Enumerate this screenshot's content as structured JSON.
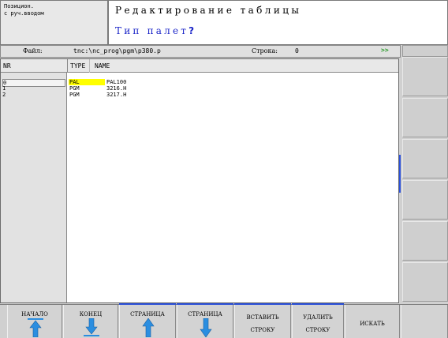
{
  "header": {
    "mode_text": "Позицион.\nс руч.вводом",
    "title": "Редактирование таблицы",
    "prompt": "Тип палет",
    "prompt_mark": "?"
  },
  "file_row": {
    "file_label": "Файл:",
    "path": "tnc:\\nc_prog\\pgm\\p380.p",
    "row_label": "Строка:",
    "row_value": "0",
    "more_indicator": ">>"
  },
  "table": {
    "columns": [
      "NR",
      "TYPE",
      "NAME"
    ],
    "rows": [
      {
        "nr": "0",
        "type": "PAL",
        "name": "PAL100",
        "selected": true
      },
      {
        "nr": "1",
        "type": "PGM",
        "name": "3216.H",
        "selected": false
      },
      {
        "nr": "2",
        "type": "PGM",
        "name": "3217.H",
        "selected": false
      }
    ]
  },
  "softkeys": {
    "start": "НАЧАЛО",
    "end": "КОНЕЦ",
    "page_up": "СТРАНИЦА",
    "page_down": "СТРАНИЦА",
    "insert_line_1": "ВСТАВИТЬ",
    "insert_line_2": "СТРОКУ",
    "delete_line_1": "УДАЛИТЬ",
    "delete_line_2": "СТРОКУ",
    "find": "ИСКАТЬ"
  },
  "colors": {
    "prompt": "#1a24c8",
    "selection": "#ffff00",
    "arrow": "#2b8ee0",
    "accent_bar": "#2b50d8",
    "more_indicator": "#2a9a2a"
  }
}
